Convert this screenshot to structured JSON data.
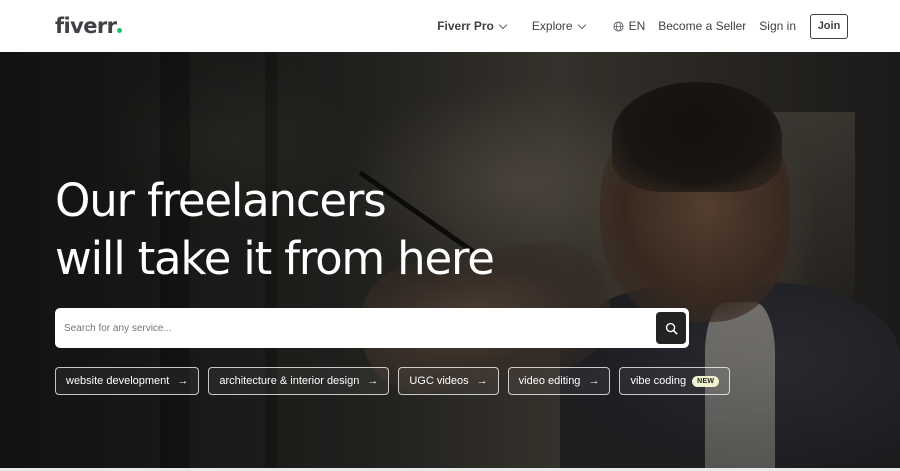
{
  "header": {
    "logo_text": "fiverr",
    "nav": {
      "pro_label": "Fiverr Pro",
      "explore_label": "Explore",
      "lang_label": "EN",
      "seller_label": "Become a Seller",
      "signin_label": "Sign in",
      "join_label": "Join"
    }
  },
  "hero": {
    "title_line1": "Our freelancers",
    "title_line2": "will take it from here",
    "search": {
      "placeholder": "Search for any service..."
    },
    "chips": [
      {
        "label": "website development",
        "arrow": "→"
      },
      {
        "label": "architecture & interior design",
        "arrow": "→"
      },
      {
        "label": "UGC videos",
        "arrow": "→"
      },
      {
        "label": "video editing",
        "arrow": "→"
      },
      {
        "label": "vibe coding",
        "badge": "NEW"
      }
    ]
  },
  "colors": {
    "brand_green": "#1dbf73",
    "text_dark": "#404145",
    "search_button": "#222325",
    "new_badge": "#f1f3d0"
  },
  "icons": {
    "search": "search-icon",
    "globe": "globe-icon",
    "chevron": "chevron-down-icon"
  }
}
